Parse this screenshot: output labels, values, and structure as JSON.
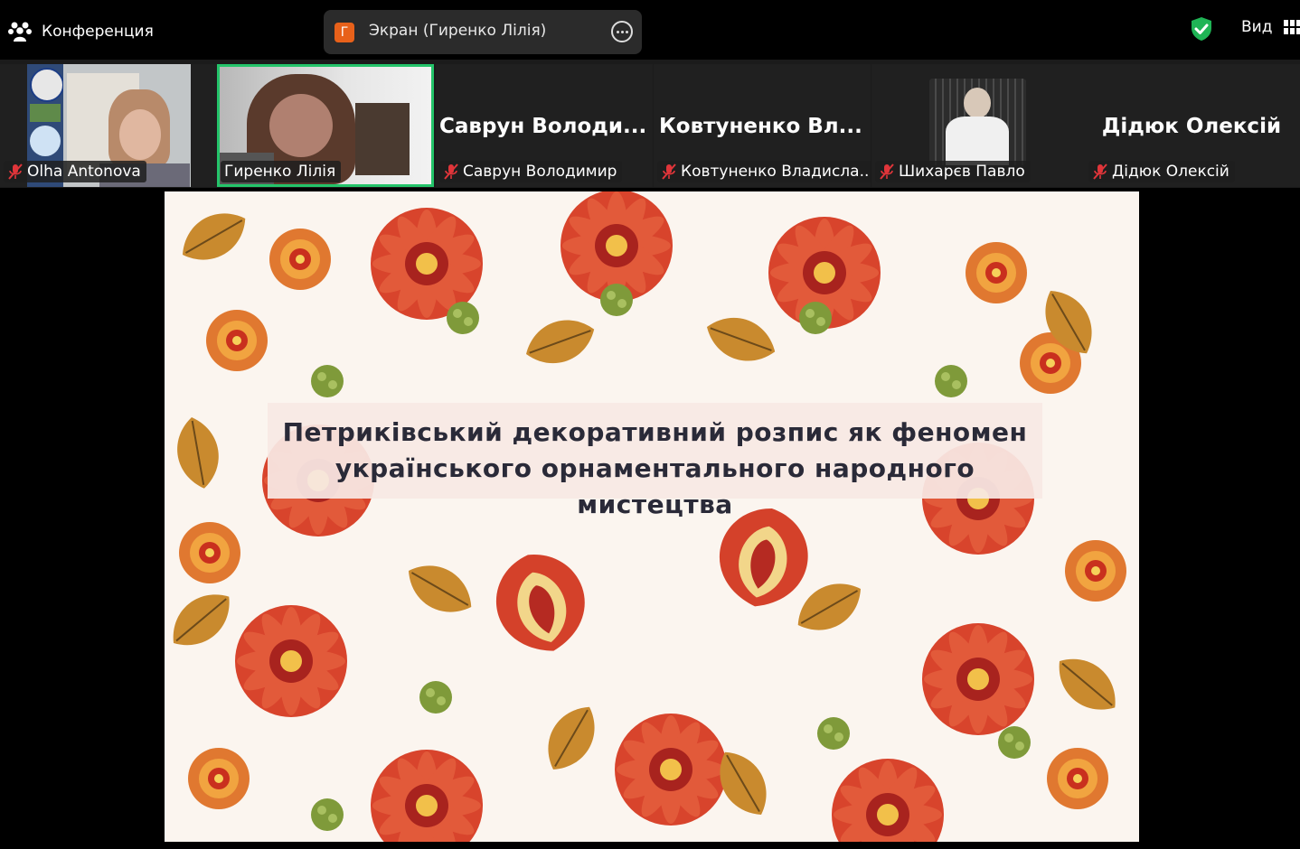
{
  "topbar": {
    "conference_label": "Конференция",
    "share_badge": "Г",
    "share_label": "Экран (Гиренко Лілія)",
    "view_label": "Вид"
  },
  "participants": [
    {
      "name": "Olha Antonova"
    },
    {
      "name": "Гиренко Лілія"
    },
    {
      "name": "Саврун Володимир",
      "big": "Саврун  Володи..."
    },
    {
      "name": "Ковтуненко Владисла...",
      "big": "Ковтуненко  Вл..."
    },
    {
      "name": "Шихарєв Павло"
    },
    {
      "name": "Дідюк Олексій",
      "big": "Дідюк Олексій"
    }
  ],
  "slide": {
    "title_line1": "Петриківський декоративний розпис як феномен",
    "title_line2": "українського орнаментального народного мистецтва"
  },
  "colors": {
    "active_border": "#24c46a",
    "share_badge": "#e8611a",
    "shield": "#1fb455",
    "mic_muted": "#e0353a"
  }
}
